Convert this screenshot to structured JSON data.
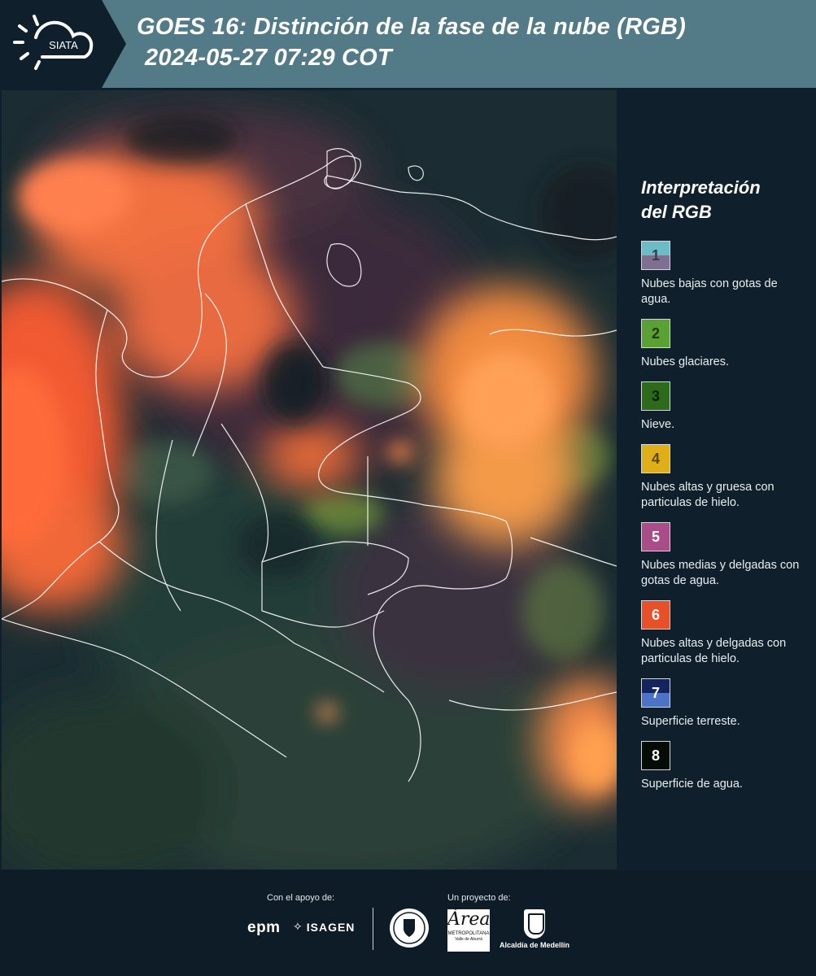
{
  "header": {
    "logo_text": "SIATA",
    "title_line1": "GOES 16: Distinción de la fase de la nube (RGB)",
    "title_line2": "2024-05-27 07:29 COT"
  },
  "legend": {
    "title_line1": "Interpretación",
    "title_line2": "del RGB",
    "items": [
      {
        "number": "1",
        "label": "Nubes bajas con gotas de agua.",
        "color_top": "#6cbcc8",
        "color_bottom": "#7d7090",
        "text_color": "#3a3a4a"
      },
      {
        "number": "2",
        "label": "Nubes glaciares.",
        "color_top": "#5aa032",
        "color_bottom": "#5aa032",
        "text_color": "#1e3a10"
      },
      {
        "number": "3",
        "label": "Nieve.",
        "color_top": "#2e6a1c",
        "color_bottom": "#2e6a1c",
        "text_color": "#0d1f08"
      },
      {
        "number": "4",
        "label": "Nubes altas y gruesa con particulas de hielo.",
        "color_top": "#e0ae18",
        "color_bottom": "#e0ae18",
        "text_color": "#5a4608"
      },
      {
        "number": "5",
        "label": "Nubes medias y delgadas con gotas de agua.",
        "color_top": "#a94c88",
        "color_bottom": "#a94c88",
        "text_color": "#ffffff"
      },
      {
        "number": "6",
        "label": "Nubes altas y delgadas con particulas de hielo.",
        "color_top": "#e8502a",
        "color_bottom": "#e8502a",
        "text_color": "#ffffff"
      },
      {
        "number": "7",
        "label": "Superficie terreste.",
        "color_top": "#13245e",
        "color_bottom": "#4d74c4",
        "text_color": "#ffffff"
      },
      {
        "number": "8",
        "label": "Superficie de agua.",
        "color_top": "#050c05",
        "color_bottom": "#050c05",
        "text_color": "#ffffff"
      }
    ]
  },
  "footer": {
    "support_label": "Con el apoyo de:",
    "project_label": "Un proyecto de:",
    "sponsor1": "epm",
    "sponsor2": "ISAGEN",
    "amva_text1": "METROPOLITANA",
    "amva_text2": "Valle de Aburrá",
    "alcaldia": "Alcaldía de Medellín"
  }
}
